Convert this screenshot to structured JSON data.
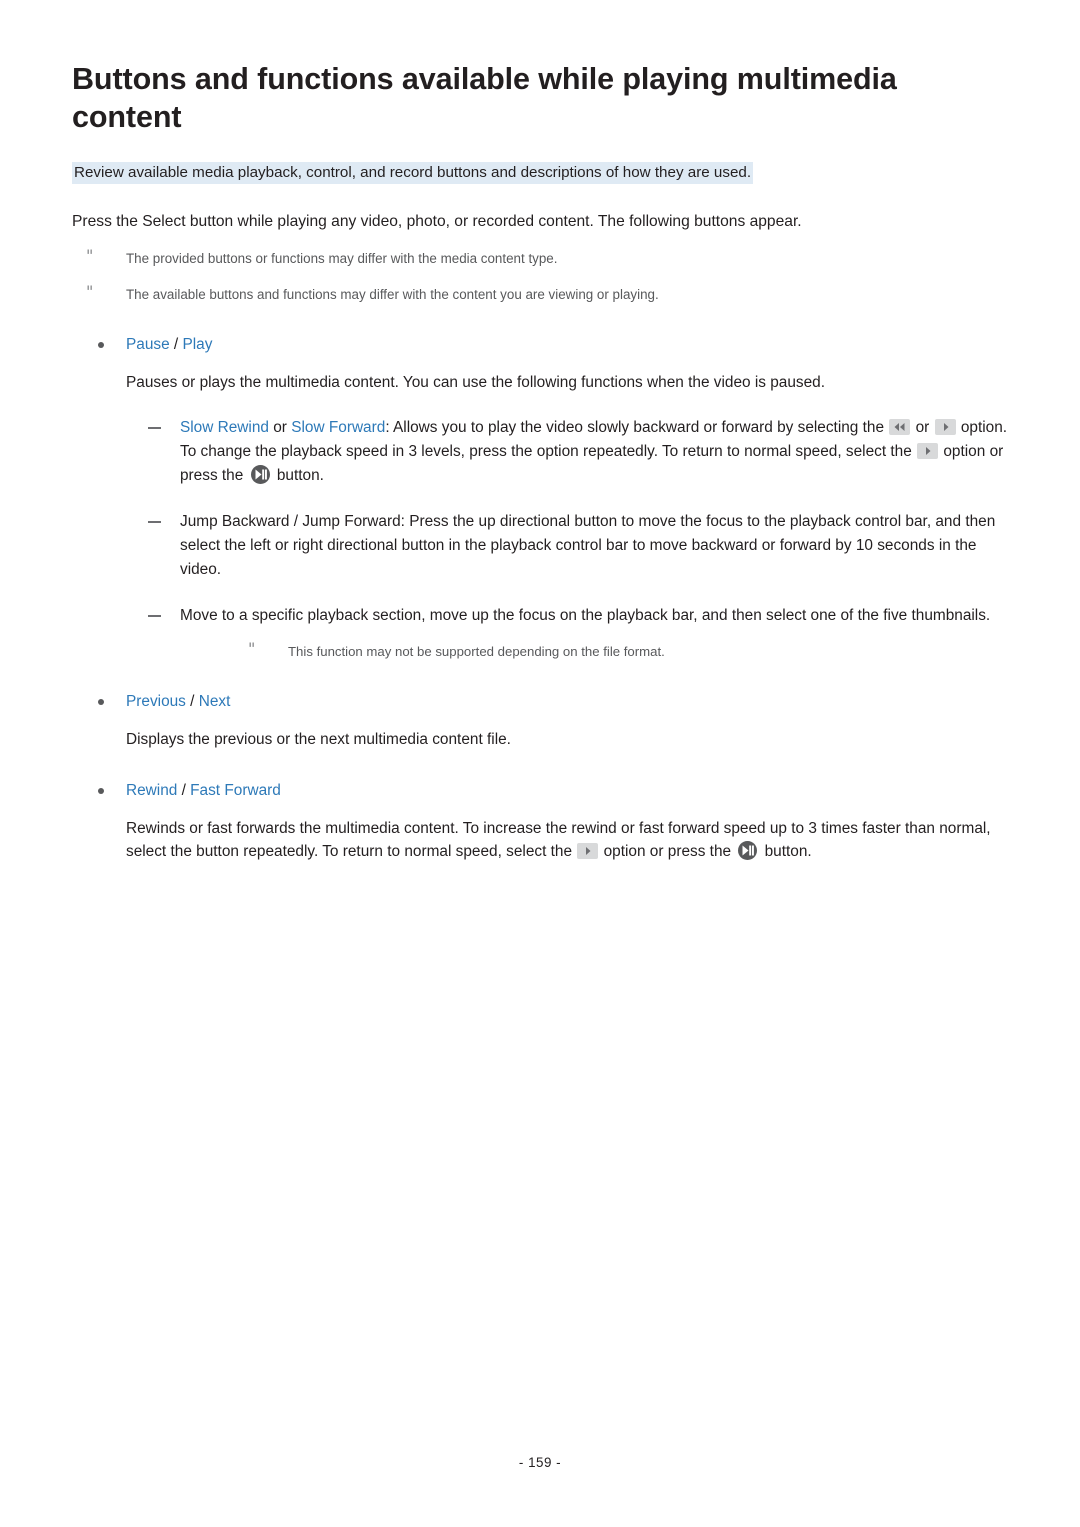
{
  "document": {
    "title": "Buttons and functions available while playing multimedia content",
    "subtitle": "Review available media playback, control, and record buttons and descriptions of how they are used.",
    "intro": "Press the Select button while playing any video, photo, or recorded content. The following buttons appear.",
    "notes": [
      "The provided buttons or functions may differ with the media content type.",
      "The available buttons and functions may differ with the content you are viewing or playing."
    ],
    "sections": [
      {
        "label_a": "Pause",
        "separator": " / ",
        "label_b": "Play",
        "body": "Pauses or plays the multimedia content. You can use the following functions when the video is paused.",
        "items": [
          {
            "link_a": "Slow Rewind",
            "mid": " or ",
            "link_b": "Slow Forward",
            "text_1": ": Allows you to play the video slowly backward or forward by selecting the ",
            "icon_1": "slow-rewind-icon",
            "text_2": " or ",
            "icon_2": "slow-forward-icon",
            "text_3": " option. To change the playback speed in 3 levels, press the option repeatedly. To return to normal speed, select the ",
            "icon_3": "forward-icon",
            "text_4": " option or press the ",
            "icon_4": "play-pause-icon",
            "text_5": " button."
          },
          {
            "text": "Jump Backward / Jump Forward: Press the up directional button to move the focus to the playback control bar, and then select the left or right directional button in the playback control bar to move backward or forward by 10 seconds in the video."
          },
          {
            "text": "Move to a specific playback section, move up the focus on the playback bar, and then select one of the five thumbnails.",
            "note": "This function may not be supported depending on the file format."
          }
        ]
      },
      {
        "label_a": "Previous",
        "separator": " / ",
        "label_b": "Next",
        "body": "Displays the previous or the next multimedia content file."
      },
      {
        "label_a": "Rewind",
        "separator": " / ",
        "label_b": "Fast Forward",
        "body_1": "Rewinds or fast forwards the multimedia content. To increase the rewind or fast forward speed up to 3 times faster than normal, select the button repeatedly. To return to normal speed, select the ",
        "icon_1": "forward-icon",
        "body_2": " option or press the ",
        "icon_2": "play-pause-icon",
        "body_3": " button."
      }
    ],
    "page_number": "- 159 -"
  },
  "colors": {
    "link": "#2d79b8",
    "highlight": "#dfeaf4",
    "body_text": "#231f20",
    "muted_text": "#58595b"
  }
}
